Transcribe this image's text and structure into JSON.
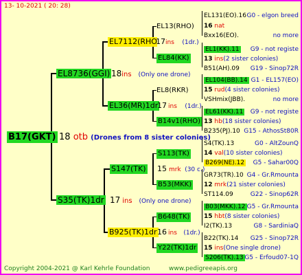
{
  "header": {
    "date": "13- 10-2021 ( 20: 28)"
  },
  "root": {
    "name": "B17(GKT)",
    "gen": "18",
    "flag": "otb",
    "note": "(Drones from 8 sister colonies)"
  },
  "g1": [
    {
      "name": "EL8736(GGI)",
      "gen": "18",
      "flag": "ins",
      "note": "(Only one drone)"
    },
    {
      "name": "S35(TK)1dr",
      "gen": "17",
      "flag": "ins",
      "note": "(Only one drone)"
    }
  ],
  "g2": [
    {
      "name": "EL7112(RHO)",
      "gen": "17",
      "flag": "ins",
      "note": "(1dr.)"
    },
    {
      "name": "EL36(MR)1dr",
      "gen": "17",
      "flag": "ins",
      "note": "(1dr.)"
    },
    {
      "name": "S147(TK)",
      "gen": "15",
      "flag": "mrk",
      "note": "(30 c.)"
    },
    {
      "name": "B925(TK)1dr",
      "gen": "16",
      "flag": "ins",
      "note": "(1dr.)"
    }
  ],
  "g3": [
    {
      "name": "EL13(RHO)"
    },
    {
      "name": "EL84(KK)"
    },
    {
      "name": "EL8(RKR)"
    },
    {
      "name": "B14v1(RHO)"
    },
    {
      "name": "S113(TK)"
    },
    {
      "name": "B53(MKK)"
    },
    {
      "name": "B648(TK)"
    },
    {
      "name": "Y22(TK)1dr"
    }
  ],
  "g4": [
    {
      "l": "EL131(EO).16",
      "r": "G0 - elgon breed"
    },
    {
      "gen": "16",
      "flag": "nat"
    },
    {
      "l": "Bxx16(EO).",
      "r": "no more"
    },
    {
      "l": "EL1(KK).11",
      "r": "G9 - not registe"
    },
    {
      "gen": "13",
      "flag": "ins",
      "note": "(2 sister colonies)"
    },
    {
      "l": "B51(AH).09",
      "r": "G19 - Sinop72R"
    },
    {
      "l": "EL104(BB).14",
      "r": "G1 - EL157(EO)"
    },
    {
      "gen": "15",
      "flag": "rud",
      "note": "(4 sister colonies)"
    },
    {
      "l": "VSHmix(JBB).",
      "r": "no more"
    },
    {
      "l": "EL61(KK).11",
      "r": "G9 - not registe"
    },
    {
      "gen": "13",
      "flag": "hb",
      "note": "(18 sister colonies)"
    },
    {
      "l": "B235(PJ).10",
      "r": "G15 - AthosSt80R"
    },
    {
      "l": "S4(TK).13",
      "r": "G0 - AltZounQ"
    },
    {
      "gen": "14",
      "flag": "val",
      "note": "(10 sister colonies)"
    },
    {
      "l": "B269(NE).12",
      "r": "G5 - Sahar00Q"
    },
    {
      "l": "GR73(TR).10",
      "r": "G4 - Gr.Rmounta"
    },
    {
      "gen": "12",
      "flag": "mrk",
      "note": "(21 sister colonies)"
    },
    {
      "l": "ST114.09",
      "r": "G22 - Sinop62R"
    },
    {
      "l": "B03(MKK).12",
      "r": "G5 - Gr.Rmounta"
    },
    {
      "gen": "15",
      "flag": "hbt",
      "note": "(8 sister colonies)"
    },
    {
      "l": "I2(TK).13",
      "r": "G8 - SardiniaQ"
    },
    {
      "l": "B22(TK).14",
      "r": "G25 - Sinop72R"
    },
    {
      "gen": "15",
      "flag": "ins",
      "note": "(One single drone)"
    },
    {
      "l": "S206(TK).13",
      "r": "G5 - Erfoud07-1Q"
    }
  ],
  "footer": {
    "copyright": "Copyright 2004-2021 @ Karl Kehrle Foundation",
    "site": "www.pedigreeapis.org"
  }
}
